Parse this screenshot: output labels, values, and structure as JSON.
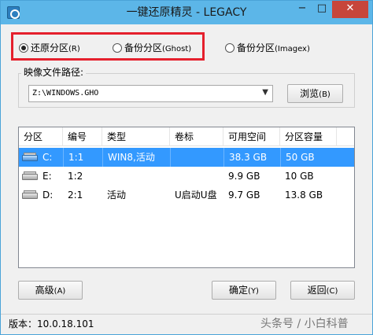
{
  "window": {
    "title": "一键还原精灵 - LEGACY",
    "min_glyph": "−",
    "max_glyph": "□",
    "close_glyph": "✕"
  },
  "mode_options": [
    {
      "label": "还原分区",
      "hotkey": "(R)",
      "selected": true
    },
    {
      "label": "备份分区",
      "hotkey": "(Ghost)",
      "selected": false
    },
    {
      "label": "备份分区",
      "hotkey": "(Imagex)",
      "selected": false
    }
  ],
  "image_path": {
    "legend": "映像文件路径:",
    "value": "Z:\\WINDOWS.GHO",
    "arrow": "▼",
    "browse_label": "浏览",
    "browse_hotkey": "(B)"
  },
  "partition_table": {
    "columns": [
      "分区",
      "编号",
      "类型",
      "卷标",
      "可用空间",
      "分区容量"
    ],
    "rows": [
      {
        "drive": "C:",
        "number": "1:1",
        "type": "WIN8,活动",
        "label": "",
        "free": "38.3 GB",
        "size": "50 GB",
        "selected": true,
        "icon": "system-drive-icon"
      },
      {
        "drive": "E:",
        "number": "1:2",
        "type": "",
        "label": "",
        "free": "9.9 GB",
        "size": "10 GB",
        "selected": false,
        "icon": "hard-drive-icon"
      },
      {
        "drive": "D:",
        "number": "2:1",
        "type": "活动",
        "label": "U启动U盘",
        "free": "9.7 GB",
        "size": "13.8 GB",
        "selected": false,
        "icon": "hard-drive-icon"
      }
    ]
  },
  "buttons": {
    "advanced": {
      "label": "高级",
      "hotkey": "(A)"
    },
    "ok": {
      "label": "确定",
      "hotkey": "(Y)"
    },
    "back": {
      "label": "返回",
      "hotkey": "(C)"
    }
  },
  "status": {
    "version": "版本：10.0.18.101",
    "watermark": "头条号 / 小白科普"
  },
  "colors": {
    "title_bar": "#5cb6e8",
    "close_button": "#c7463b",
    "selection": "#3399ff",
    "highlight_box": "#e5202d"
  }
}
